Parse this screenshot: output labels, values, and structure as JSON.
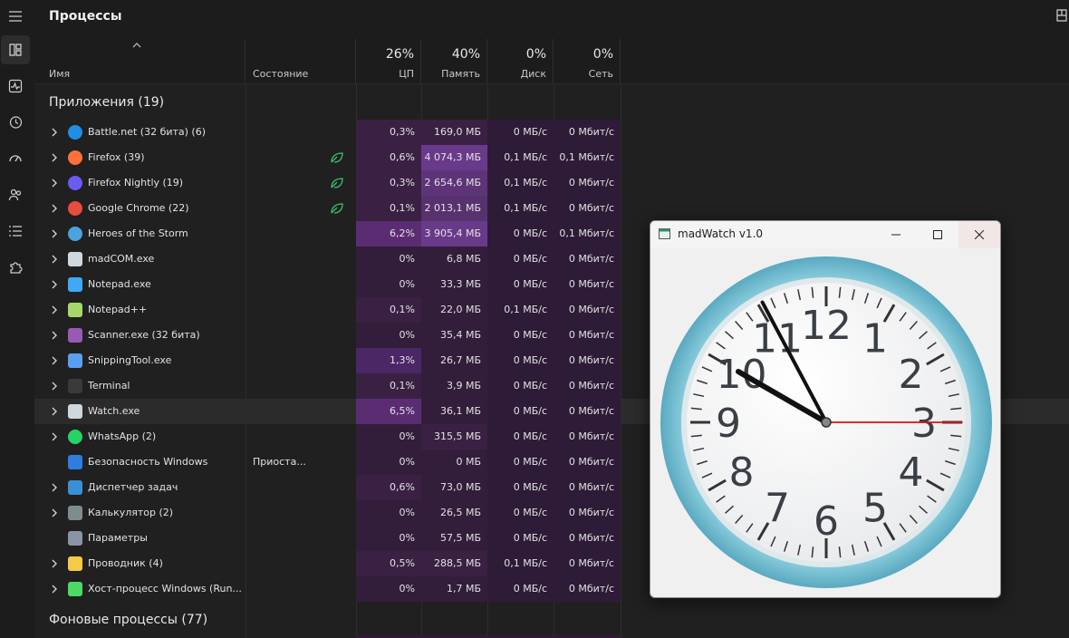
{
  "page": {
    "title": "Процессы"
  },
  "columns": {
    "name": "Имя",
    "state": "Состояние",
    "cpu": {
      "pct": "26%",
      "label": "ЦП"
    },
    "mem": {
      "pct": "40%",
      "label": "Память"
    },
    "disk": {
      "pct": "0%",
      "label": "Диск"
    },
    "net": {
      "pct": "0%",
      "label": "Сеть"
    }
  },
  "groups": {
    "apps": "Приложения (19)",
    "background": "Фоновые процессы (77)"
  },
  "rows": [
    {
      "name": "Battle.net (32 бита) (6)",
      "state": "",
      "cpu": "0,3%",
      "mem": "169,0 МБ",
      "disk": "0 МБ/с",
      "net": "0 Мбит/с",
      "icon": "battlenet-icon",
      "color": "#1f8fe6",
      "chev": true,
      "leaf": false
    },
    {
      "name": "Firefox (39)",
      "state": "",
      "cpu": "0,6%",
      "mem": "4 074,3 МБ",
      "disk": "0,1 МБ/с",
      "net": "0,1 Мбит/с",
      "icon": "firefox-icon",
      "color": "#ff7139",
      "chev": true,
      "leaf": true
    },
    {
      "name": "Firefox Nightly (19)",
      "state": "",
      "cpu": "0,3%",
      "mem": "2 654,6 МБ",
      "disk": "0,1 МБ/с",
      "net": "0 Мбит/с",
      "icon": "firefox-nightly-icon",
      "color": "#6a5cf0",
      "chev": true,
      "leaf": true
    },
    {
      "name": "Google Chrome (22)",
      "state": "",
      "cpu": "0,1%",
      "mem": "2 013,1 МБ",
      "disk": "0,1 МБ/с",
      "net": "0 Мбит/с",
      "icon": "chrome-icon",
      "color": "#e74c3c",
      "chev": true,
      "leaf": true
    },
    {
      "name": "Heroes of the Storm",
      "state": "",
      "cpu": "6,2%",
      "mem": "3 905,4 МБ",
      "disk": "0 МБ/с",
      "net": "0,1 Мбит/с",
      "icon": "heroes-icon",
      "color": "#4aa3e0",
      "chev": true,
      "leaf": false
    },
    {
      "name": "madCOM.exe",
      "state": "",
      "cpu": "0%",
      "mem": "6,8 МБ",
      "disk": "0 МБ/с",
      "net": "0 Мбит/с",
      "icon": "window-app-icon",
      "color": "#cfd8dc",
      "chev": true,
      "leaf": false
    },
    {
      "name": "Notepad.exe",
      "state": "",
      "cpu": "0%",
      "mem": "33,3 МБ",
      "disk": "0 МБ/с",
      "net": "0 Мбит/с",
      "icon": "notepad-icon",
      "color": "#3fa9f5",
      "chev": true,
      "leaf": false
    },
    {
      "name": "Notepad++",
      "state": "",
      "cpu": "0,1%",
      "mem": "22,0 МБ",
      "disk": "0,1 МБ/с",
      "net": "0 Мбит/с",
      "icon": "notepadpp-icon",
      "color": "#a5d86a",
      "chev": true,
      "leaf": false
    },
    {
      "name": "Scanner.exe (32 бита)",
      "state": "",
      "cpu": "0%",
      "mem": "35,4 МБ",
      "disk": "0 МБ/с",
      "net": "0 Мбит/с",
      "icon": "scanner-icon",
      "color": "#9b59b6",
      "chev": true,
      "leaf": false
    },
    {
      "name": "SnippingTool.exe",
      "state": "",
      "cpu": "1,3%",
      "mem": "26,7 МБ",
      "disk": "0 МБ/с",
      "net": "0 Мбит/с",
      "icon": "snipping-icon",
      "color": "#5aa0f0",
      "chev": true,
      "leaf": false
    },
    {
      "name": "Terminal",
      "state": "",
      "cpu": "0,1%",
      "mem": "3,9 МБ",
      "disk": "0 МБ/с",
      "net": "0 Мбит/с",
      "icon": "terminal-icon",
      "color": "#3a3a3a",
      "chev": true,
      "leaf": false
    },
    {
      "name": "Watch.exe",
      "state": "",
      "cpu": "6,5%",
      "mem": "36,1 МБ",
      "disk": "0 МБ/с",
      "net": "0 Мбит/с",
      "icon": "window-app-icon",
      "color": "#cfd8dc",
      "chev": true,
      "leaf": false,
      "highlight": true
    },
    {
      "name": "WhatsApp (2)",
      "state": "",
      "cpu": "0%",
      "mem": "315,5 МБ",
      "disk": "0 МБ/с",
      "net": "0 Мбит/с",
      "icon": "whatsapp-icon",
      "color": "#25d366",
      "chev": true,
      "leaf": false
    },
    {
      "name": "Безопасность Windows",
      "state": "Приоста...",
      "cpu": "0%",
      "mem": "0 МБ",
      "disk": "0 МБ/с",
      "net": "0 Мбит/с",
      "icon": "shield-icon",
      "color": "#2f7de1",
      "chev": false,
      "leaf": false
    },
    {
      "name": "Диспетчер задач",
      "state": "",
      "cpu": "0,6%",
      "mem": "73,0 МБ",
      "disk": "0 МБ/с",
      "net": "0 Мбит/с",
      "icon": "taskmgr-icon",
      "color": "#3a8fd9",
      "chev": true,
      "leaf": false
    },
    {
      "name": "Калькулятор (2)",
      "state": "",
      "cpu": "0%",
      "mem": "26,5 МБ",
      "disk": "0 МБ/с",
      "net": "0 Мбит/с",
      "icon": "calculator-icon",
      "color": "#7f8c8d",
      "chev": true,
      "leaf": false
    },
    {
      "name": "Параметры",
      "state": "",
      "cpu": "0%",
      "mem": "57,5 МБ",
      "disk": "0 МБ/с",
      "net": "0 Мбит/с",
      "icon": "gear-icon",
      "color": "#8a94a6",
      "chev": false,
      "leaf": false
    },
    {
      "name": "Проводник (4)",
      "state": "",
      "cpu": "0,5%",
      "mem": "288,5 МБ",
      "disk": "0,1 МБ/с",
      "net": "0 Мбит/с",
      "icon": "folder-icon",
      "color": "#f7c948",
      "chev": true,
      "leaf": false
    },
    {
      "name": "Хост-процесс Windows (Run...",
      "state": "",
      "cpu": "0%",
      "mem": "1,7 МБ",
      "disk": "0 МБ/с",
      "net": "0 Мбит/с",
      "icon": "host-process-icon",
      "color": "#4cd964",
      "chev": true,
      "leaf": false
    }
  ],
  "heat": {
    "cpu": [
      "#3a2143",
      "#3a2143",
      "#3a2143",
      "#3a2143",
      "#5a2d73",
      "#321d3b",
      "#321d3b",
      "#3a2143",
      "#321d3b",
      "#4b2766",
      "#3a2143",
      "#5a2d73",
      "#321d3b",
      "#321d3b",
      "#3a2143",
      "#321d3b",
      "#321d3b",
      "#3a2143",
      "#321d3b"
    ],
    "mem": [
      "#3a2143",
      "#6a3a8a",
      "#5e3479",
      "#58316f",
      "#6a3a8a",
      "#321d3b",
      "#321d3b",
      "#321d3b",
      "#321d3b",
      "#321d3b",
      "#321d3b",
      "#321d3b",
      "#3a2143",
      "#321d3b",
      "#321d3b",
      "#321d3b",
      "#321d3b",
      "#3a2143",
      "#321d3b"
    ],
    "base": "#2e1b37"
  },
  "watch": {
    "title": "madWatch v1.0",
    "numerals": [
      "12",
      "1",
      "2",
      "3",
      "4",
      "5",
      "6",
      "7",
      "8",
      "9",
      "10",
      "11"
    ],
    "hour_hand_deg": 300,
    "minute_hand_deg": 332,
    "second_hand_deg": 90
  }
}
